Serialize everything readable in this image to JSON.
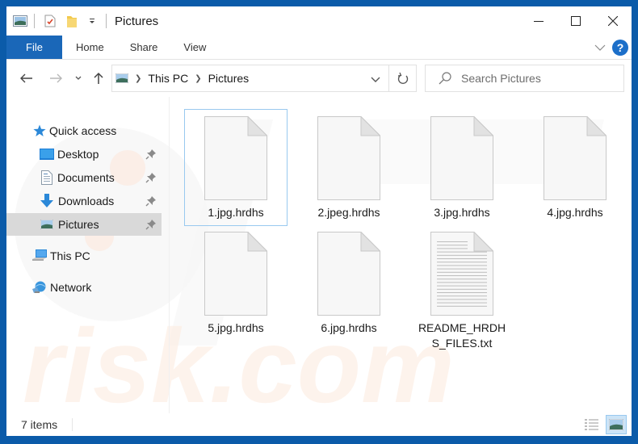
{
  "window": {
    "title": "Pictures",
    "controls": {
      "minimize": "minimize",
      "maximize": "maximize",
      "close": "close"
    }
  },
  "quick_access_toolbar": {
    "icons": [
      "pictures-folder-icon",
      "properties-icon",
      "new-folder-icon",
      "customize-dropdown-icon"
    ]
  },
  "ribbon": {
    "tabs": [
      {
        "label": "File",
        "active": true
      },
      {
        "label": "Home"
      },
      {
        "label": "Share"
      },
      {
        "label": "View"
      }
    ],
    "help_label": "?"
  },
  "navigation": {
    "back": "back",
    "forward": "forward",
    "recent": "recent-locations",
    "up": "up",
    "breadcrumb": [
      "This PC",
      "Pictures"
    ],
    "search_placeholder": "Search Pictures"
  },
  "sidebar": {
    "quick_access_label": "Quick access",
    "items": [
      {
        "label": "Desktop",
        "pinned": true
      },
      {
        "label": "Documents",
        "pinned": true
      },
      {
        "label": "Downloads",
        "pinned": true
      },
      {
        "label": "Pictures",
        "pinned": true,
        "selected": true
      }
    ],
    "this_pc_label": "This PC",
    "network_label": "Network"
  },
  "files": [
    {
      "name": "1.jpg.hrdhs",
      "type": "blank"
    },
    {
      "name": "2.jpeg.hrdhs",
      "type": "blank"
    },
    {
      "name": "3.jpg.hrdhs",
      "type": "blank"
    },
    {
      "name": "4.jpg.hrdhs",
      "type": "blank"
    },
    {
      "name": "5.jpg.hrdhs",
      "type": "blank"
    },
    {
      "name": "6.jpg.hrdhs",
      "type": "blank"
    },
    {
      "name": "README_HRDHS_FILES.txt",
      "type": "text"
    }
  ],
  "status": {
    "item_count": "7 items",
    "view_modes": [
      "details",
      "large-icons"
    ],
    "active_view": "large-icons"
  },
  "colors": {
    "accent": "#1a67b8",
    "frame": "#0b5ba9",
    "selection": "#d9d9d9",
    "focus_border": "#99c9ef"
  }
}
